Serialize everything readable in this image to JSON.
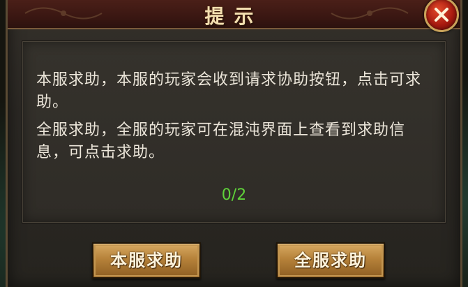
{
  "dialog": {
    "title": "提示",
    "close_icon": "close-x-icon",
    "paragraphs": [
      "本服求助，本服的玩家会收到请求协助按钮，点击可求助。",
      "全服求助，全服的玩家可在混沌界面上查看到求助信息，可点击求助。"
    ],
    "counter": "0/2",
    "buttons": {
      "local_help": "本服求助",
      "global_help": "全服求助"
    }
  },
  "colors": {
    "counter_green": "#5fd23a",
    "title_gold": "#f3dfb0",
    "button_gold": "#b6823a",
    "close_red": "#a81a10"
  }
}
